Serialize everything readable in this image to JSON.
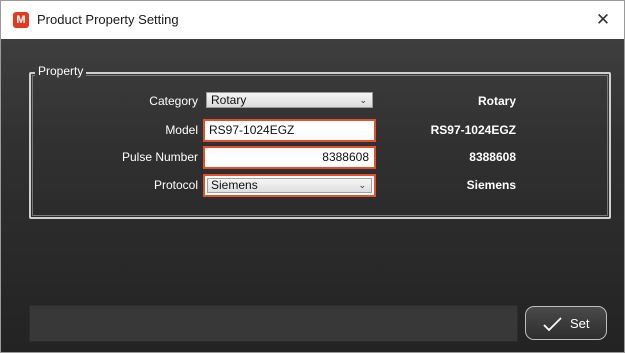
{
  "window": {
    "title": "Product Property Setting",
    "app_icon_letter": "M",
    "close_glyph": "✕"
  },
  "property_group": {
    "legend": "Property",
    "rows": [
      {
        "label": "Category",
        "input_value": "Rotary",
        "current_value": "Rotary"
      },
      {
        "label": "Model",
        "input_value": "RS97-1024EGZ",
        "current_value": "RS97-1024EGZ"
      },
      {
        "label": "Pulse Number",
        "input_value": "8388608",
        "current_value": "8388608"
      },
      {
        "label": "Protocol",
        "input_value": "Siemens",
        "current_value": "Siemens"
      }
    ]
  },
  "footer": {
    "status_text": "",
    "set_label": "Set"
  },
  "colors": {
    "highlight": "#e3512c",
    "app_icon": "#e03a22"
  }
}
